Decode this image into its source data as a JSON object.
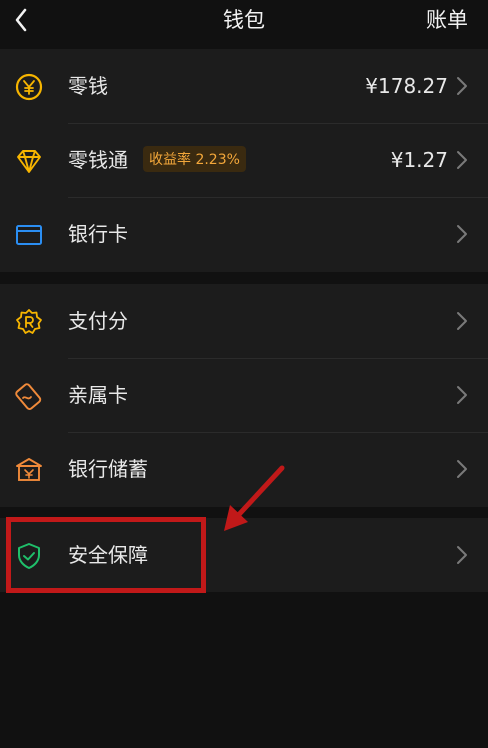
{
  "header": {
    "title": "钱包",
    "right_action": "账单",
    "back_icon": "chevron-left-icon"
  },
  "groups": [
    {
      "items": [
        {
          "label": "零钱",
          "value": "¥178.27",
          "icon": "yen-coin-icon",
          "icon_color": "#f7b500"
        },
        {
          "label": "零钱通",
          "badge": "收益率 2.23%",
          "value": "¥1.27",
          "icon": "diamond-icon",
          "icon_color": "#f7b500"
        },
        {
          "label": "银行卡",
          "value": "",
          "icon": "bank-card-icon",
          "icon_color": "#2b8ef2"
        }
      ]
    },
    {
      "items": [
        {
          "label": "支付分",
          "value": "",
          "icon": "score-badge-icon",
          "icon_color": "#f7b500"
        },
        {
          "label": "亲属卡",
          "value": "",
          "icon": "family-card-icon",
          "icon_color": "#f08a3a"
        },
        {
          "label": "银行储蓄",
          "value": "",
          "icon": "bank-building-icon",
          "icon_color": "#f08a3a"
        }
      ]
    },
    {
      "items": [
        {
          "label": "安全保障",
          "value": "",
          "icon": "shield-check-icon",
          "icon_color": "#1fbf6a"
        }
      ]
    }
  ],
  "annotation": {
    "highlight_color": "#c11919",
    "arrow_color": "#c11919"
  }
}
